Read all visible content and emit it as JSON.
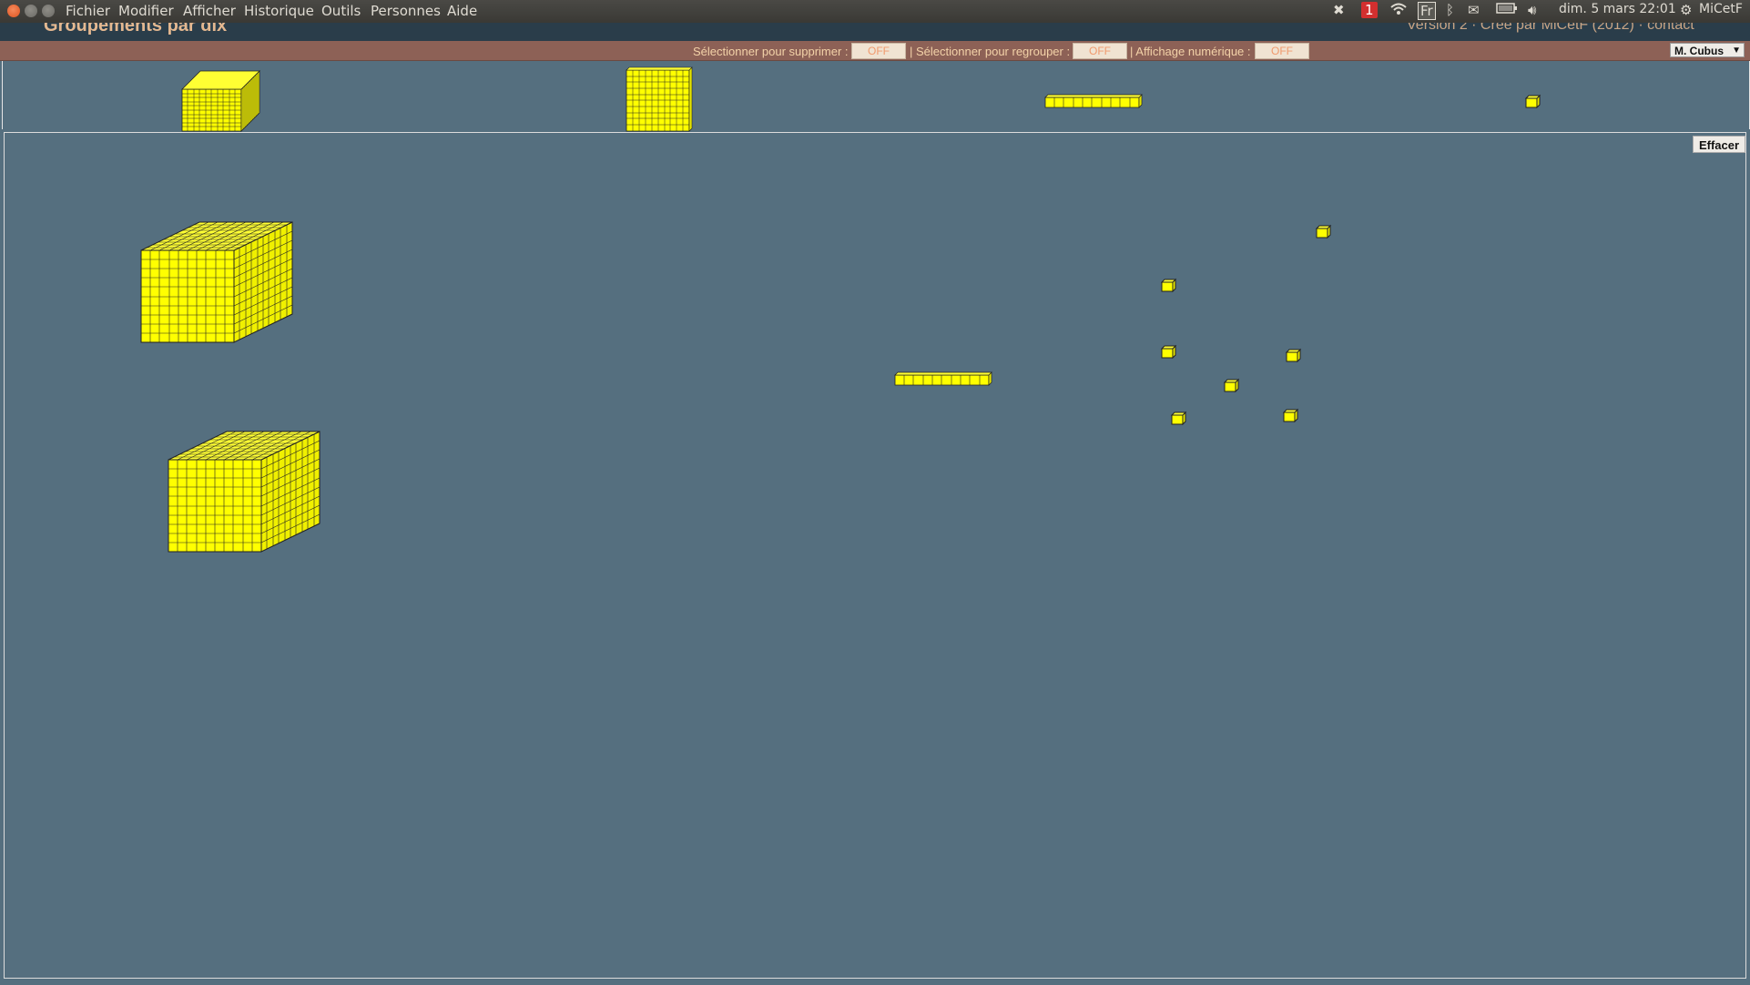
{
  "menubar": {
    "items": [
      "Fichier",
      "Modifier",
      "Afficher",
      "Historique",
      "Outils",
      "Personnes",
      "Aide"
    ],
    "tray": {
      "badge": "1",
      "language": "Fr",
      "clock": "dim.  5 mars 22:01",
      "user": "MiCetF"
    }
  },
  "app": {
    "title": "Groupements par dix",
    "version_line": "Version 2 · Créé par MiCetF (2012) · contact"
  },
  "toolbar": {
    "delete_label": "Sélectionner pour supprimer :",
    "delete_state": "OFF",
    "group_label": "| Sélectionner pour regrouper :",
    "group_state": "OFF",
    "numeric_label": "| Affichage numérique :",
    "numeric_state": "OFF",
    "user_selected": "M. Cubus"
  },
  "workspace": {
    "clear_label": "Effacer"
  },
  "palette": [
    "thousand-cube",
    "hundred-flat",
    "ten-rod",
    "unit-cube"
  ],
  "workspace_blocks": {
    "thousands": 2,
    "hundreds": 0,
    "tens": 1,
    "units": 7
  },
  "colors": {
    "block_yellow": "#ffff00",
    "block_shade": "#e6e600",
    "workspace_bg": "#556f7f",
    "toolbar_bg": "#8d6156",
    "toggle_text": "#f09a6d"
  }
}
